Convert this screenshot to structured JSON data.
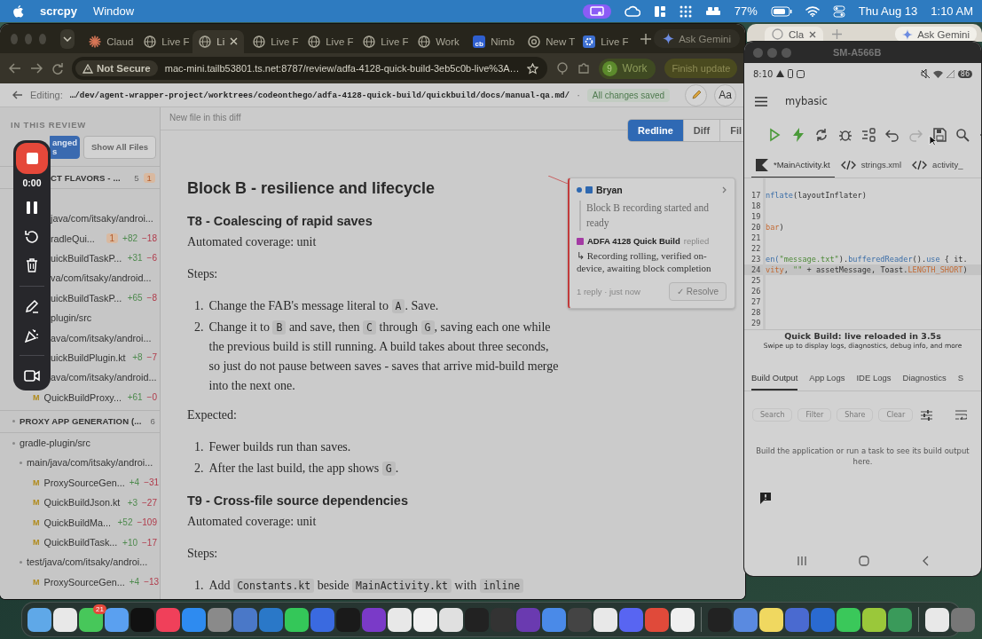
{
  "menu_bar": {
    "app": "scrcpy",
    "menus": [
      "Window"
    ],
    "battery": "77%",
    "date": "Thu Aug 13",
    "time": "1:10 AM"
  },
  "browser": {
    "tabs": [
      {
        "title": "Claud",
        "kind": "claude",
        "selected": false
      },
      {
        "title": "Live F",
        "kind": "globe",
        "selected": false
      },
      {
        "title": "Li",
        "kind": "globe",
        "selected": true
      },
      {
        "title": "Live F",
        "kind": "globe",
        "selected": false
      },
      {
        "title": "Live F",
        "kind": "globe",
        "selected": false
      },
      {
        "title": "Live F",
        "kind": "globe",
        "selected": false
      },
      {
        "title": "Work",
        "kind": "globe",
        "selected": false
      },
      {
        "title": "Nimb",
        "kind": "letters",
        "icon_text": "cb",
        "selected": false
      },
      {
        "title": "New T",
        "kind": "chrome",
        "selected": false
      },
      {
        "title": "Live F",
        "kind": "gear",
        "selected": false
      }
    ],
    "gemini": "Ask Gemini",
    "security": "Not Secure",
    "url": "mac-mini.tailb53801.ts.net:8787/review/adfa-4128-quick-build-3eb5c0b-live%3A…",
    "profile_badge": "9",
    "profile": "Work",
    "update": "Finish update"
  },
  "editor_header": {
    "label": "Editing:",
    "path": "…/dev/agent-wrapper-project/worktrees/codeonthego/adfa-4128-quick-build/quickbuild/docs/manual-qa.md/",
    "separator": "·",
    "status": "All changes saved",
    "font_button": "Aa"
  },
  "sidebar": {
    "heading": "IN THIS REVIEW",
    "buttons": [
      {
        "label": "anged\ns",
        "selected": true
      },
      {
        "label": "Show All Files",
        "selected": false
      }
    ],
    "sections": [
      {
        "title": "CT FLAVORS - ...",
        "count": "5",
        "badge": "1",
        "children": [
          {
            "kind": "folder",
            "label": "java/com/itsaky/androi...",
            "children": [
              {
                "kind": "file",
                "label": "radleQui...",
                "badge": "1",
                "added": "+82",
                "removed": "−18"
              },
              {
                "kind": "file",
                "label": "uickBuildTaskP...",
                "added": "+31",
                "removed": "−6"
              }
            ]
          },
          {
            "kind": "folder",
            "label": "va/com/itsaky/android...",
            "children": [
              {
                "kind": "file",
                "label": "uickBuildTaskP...",
                "added": "+65",
                "removed": "−8"
              }
            ]
          },
          {
            "kind": "folder",
            "label": "plugin/src",
            "children": [
              {
                "kind": "folder",
                "label": "ava/com/itsaky/androi...",
                "children": [
                  {
                    "kind": "file",
                    "label": "uickBuildPlugin.kt",
                    "added": "+8",
                    "removed": "−7"
                  }
                ]
              },
              {
                "kind": "folder",
                "label": "ava/com/itsaky/android...",
                "children": [
                  {
                    "kind": "file",
                    "marker": "M",
                    "label": "QuickBuildProxy...",
                    "added": "+61",
                    "removed": "−0"
                  }
                ]
              }
            ]
          }
        ]
      },
      {
        "title": "PROXY APP GENERATION (...",
        "count": "6",
        "children": [
          {
            "kind": "folder",
            "label": "gradle-plugin/src",
            "children": [
              {
                "kind": "folder",
                "label": "main/java/com/itsaky/androi...",
                "children": [
                  {
                    "kind": "file",
                    "marker": "M",
                    "label": "ProxySourceGen...",
                    "added": "+4",
                    "removed": "−31"
                  },
                  {
                    "kind": "file",
                    "marker": "M",
                    "label": "QuickBuildJson.kt",
                    "added": "+3",
                    "removed": "−27"
                  },
                  {
                    "kind": "file",
                    "marker": "M",
                    "label": "QuickBuildMa...",
                    "added": "+52",
                    "removed": "−109"
                  },
                  {
                    "kind": "file",
                    "marker": "M",
                    "label": "QuickBuildTask...",
                    "added": "+10",
                    "removed": "−17"
                  }
                ]
              },
              {
                "kind": "folder",
                "label": "test/java/com/itsaky/androi...",
                "children": [
                  {
                    "kind": "file",
                    "marker": "M",
                    "label": "ProxySourceGen...",
                    "added": "+4",
                    "removed": "−13"
                  }
                ]
              }
            ]
          }
        ]
      }
    ]
  },
  "doc": {
    "notice": "New file in this diff",
    "views": [
      {
        "label": "Redline",
        "selected": true
      },
      {
        "label": "Diff",
        "selected": false
      },
      {
        "label": "Fil",
        "selected": false
      }
    ],
    "blocks": [
      {
        "kind": "h2",
        "text": "Block B - resilience and lifecycle"
      },
      {
        "kind": "h3",
        "text": "T8 - Coalescing of rapid saves"
      },
      {
        "kind": "p",
        "text": "Automated coverage: unit"
      },
      {
        "kind": "p",
        "text": "Steps:"
      },
      {
        "kind": "ol",
        "items": [
          {
            "number": "1.",
            "parts": [
              {
                "kind": "text",
                "text": "Change the FAB's message literal to "
              },
              {
                "kind": "code",
                "text": "A"
              },
              {
                "kind": "text",
                "text": ". Save."
              }
            ]
          },
          {
            "number": "2.",
            "parts": [
              {
                "kind": "text",
                "text": "Change it to "
              },
              {
                "kind": "code",
                "text": "B"
              },
              {
                "kind": "text",
                "text": " and save, then "
              },
              {
                "kind": "code",
                "text": "C"
              },
              {
                "kind": "text",
                "text": " through "
              },
              {
                "kind": "code",
                "text": "G"
              },
              {
                "kind": "text",
                "text": ", saving each one while the previous build is still running. A build takes about three seconds, so just do not pause between saves - saves that arrive mid-build merge into the next one."
              }
            ]
          }
        ]
      },
      {
        "kind": "p",
        "text": "Expected:"
      },
      {
        "kind": "ol",
        "items": [
          {
            "number": "1.",
            "parts": [
              {
                "kind": "text",
                "text": "Fewer builds run than saves."
              }
            ]
          },
          {
            "number": "2.",
            "parts": [
              {
                "kind": "text",
                "text": "After the last build, the app shows "
              },
              {
                "kind": "code",
                "text": "G"
              },
              {
                "kind": "text",
                "text": "."
              }
            ]
          }
        ]
      },
      {
        "kind": "h3",
        "text": "T9 - Cross-file source dependencies"
      },
      {
        "kind": "p",
        "text": "Automated coverage: unit"
      },
      {
        "kind": "p",
        "text": "Steps:"
      },
      {
        "kind": "ol",
        "items": [
          {
            "number": "1.",
            "parts": [
              {
                "kind": "text",
                "text": "Add "
              },
              {
                "kind": "code",
                "text": "Constants.kt"
              },
              {
                "kind": "text",
                "text": " beside "
              },
              {
                "kind": "code",
                "text": "MainActivity.kt"
              },
              {
                "kind": "text",
                "text": " with "
              },
              {
                "kind": "code",
                "text": "inline"
              }
            ]
          }
        ]
      }
    ],
    "comment": {
      "author": "Bryan",
      "quote": "Block B recording started and ready",
      "reply_author": "ADFA 4128 Quick Build",
      "reply_verb": "replied",
      "reply": "↳ Recording rolling, verified on-device, awaiting block completion",
      "meta": "1 reply · just now",
      "resolve": "✓ Resolve"
    }
  },
  "recorder": {
    "time": "0:00"
  },
  "back_browser": {
    "tab": "Cla",
    "gemini": "Ask Gemini"
  },
  "phone": {
    "title": "SM-A566B",
    "status_time": "8:10",
    "battery": "86",
    "app_title": "mybasic",
    "file_tabs": [
      {
        "label": "*MainActivity.kt",
        "kind": "kotlin",
        "selected": true
      },
      {
        "label": "strings.xml",
        "kind": "xml",
        "selected": false
      },
      {
        "label": "activity_",
        "kind": "xml",
        "selected": false
      }
    ],
    "code_lines": [
      {
        "number": "17",
        "current": false,
        "parts": [
          {
            "kind": "fn",
            "text": "nflate"
          },
          {
            "kind": "plain",
            "text": "(layoutInflater)"
          }
        ]
      },
      {
        "number": "18",
        "current": false
      },
      {
        "number": "19",
        "current": false
      },
      {
        "number": "20",
        "current": false,
        "parts": [
          {
            "kind": "const",
            "text": "bar"
          },
          {
            "kind": "plain",
            "text": ")"
          }
        ]
      },
      {
        "number": "21",
        "current": false
      },
      {
        "number": "22",
        "current": false
      },
      {
        "number": "23",
        "current": false,
        "parts": [
          {
            "kind": "fn",
            "text": "en("
          },
          {
            "kind": "str",
            "text": "\"message.txt\""
          },
          {
            "kind": "plain",
            "text": ")."
          },
          {
            "kind": "fn",
            "text": "bufferedReader"
          },
          {
            "kind": "plain",
            "text": "()."
          },
          {
            "kind": "fn",
            "text": "use"
          },
          {
            "kind": "plain",
            "text": " { it."
          }
        ]
      },
      {
        "number": "24",
        "current": true,
        "parts": [
          {
            "kind": "const",
            "text": "vity"
          },
          {
            "kind": "plain",
            "text": ", "
          },
          {
            "kind": "str",
            "text": "\"\""
          },
          {
            "kind": "plain",
            "text": " + assetMessage, Toast."
          },
          {
            "kind": "const",
            "text": "LENGTH_SHORT"
          },
          {
            "kind": "plain",
            "text": ")"
          }
        ]
      },
      {
        "number": "25",
        "current": false
      },
      {
        "number": "26",
        "current": false
      },
      {
        "number": "27",
        "current": false
      },
      {
        "number": "28",
        "current": false
      },
      {
        "number": "29",
        "current": false
      }
    ],
    "status_title": "Quick Build: live reloaded in 3.5s",
    "status_hint": "Swipe up to display logs, diagnostics, debug info, and more",
    "panel_tabs": [
      {
        "label": "Build Output",
        "selected": true
      },
      {
        "label": "App Logs",
        "selected": false
      },
      {
        "label": "IDE Logs",
        "selected": false
      },
      {
        "label": "Diagnostics",
        "selected": false
      },
      {
        "label": "S",
        "selected": false
      }
    ],
    "panel_buttons": [
      {
        "label": "Search",
        "disabled": true
      },
      {
        "label": "Filter",
        "disabled": true
      },
      {
        "label": "Share",
        "disabled": true
      },
      {
        "label": "Clear",
        "disabled": true
      }
    ],
    "empty_message": "Build the application or run a task to see its build output here."
  },
  "dock": {
    "badge": "21"
  }
}
